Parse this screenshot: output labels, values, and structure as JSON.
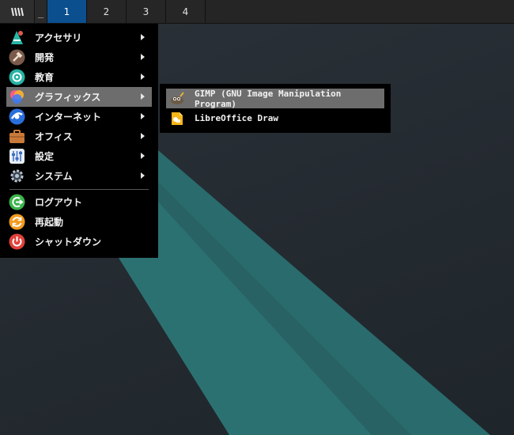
{
  "panel": {
    "workspaces": [
      "1",
      "2",
      "3",
      "4"
    ],
    "active_workspace": "1",
    "minimize_label": "_"
  },
  "menu": {
    "items": [
      {
        "label": "アクセサリ",
        "icon": "accessories-icon",
        "has_submenu": true
      },
      {
        "label": "開発",
        "icon": "development-icon",
        "has_submenu": true
      },
      {
        "label": "教育",
        "icon": "education-icon",
        "has_submenu": true
      },
      {
        "label": "グラフィックス",
        "icon": "graphics-icon",
        "has_submenu": true,
        "selected": true
      },
      {
        "label": "インターネット",
        "icon": "internet-icon",
        "has_submenu": true
      },
      {
        "label": "オフィス",
        "icon": "office-icon",
        "has_submenu": true
      },
      {
        "label": "設定",
        "icon": "settings-icon",
        "has_submenu": true
      },
      {
        "label": "システム",
        "icon": "system-icon",
        "has_submenu": true
      }
    ],
    "session": [
      {
        "label": "ログアウト",
        "icon": "logout-icon"
      },
      {
        "label": "再起動",
        "icon": "reboot-icon"
      },
      {
        "label": "シャットダウン",
        "icon": "shutdown-icon"
      }
    ]
  },
  "submenu": {
    "items": [
      {
        "label": "GIMP (GNU Image Manipulation Program)",
        "icon": "gimp-icon",
        "selected": true
      },
      {
        "label": "LibreOffice Draw",
        "icon": "libreoffice-draw-icon"
      }
    ]
  },
  "colors": {
    "active_workspace": "#0b4f8f",
    "menu_background": "#000000",
    "selection": "#6d6d6d",
    "wallpaper_stripe": "#2a6e6e"
  }
}
